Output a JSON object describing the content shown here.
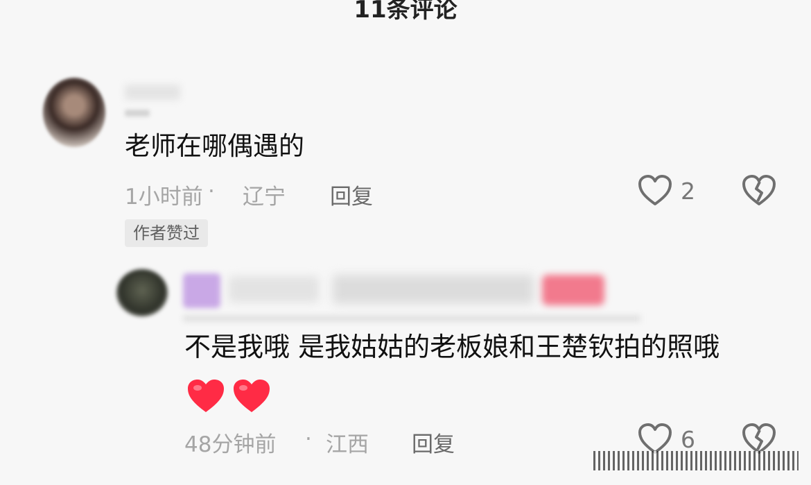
{
  "header": {
    "title": "11条评论"
  },
  "comment": {
    "text": "老师在哪偶遇的",
    "time": "1小时前",
    "separator": "·",
    "location": "辽宁",
    "reply_label": "回复",
    "like_count": "2",
    "badge": "作者赞过"
  },
  "reply_comment": {
    "text": "不是我哦 是我姑姑的老板娘和王楚钦拍的照哦",
    "time": "48分钟前",
    "separator": "·",
    "location": "江西",
    "reply_label": "回复",
    "like_count": "6"
  },
  "colors": {
    "heart_red": "#ff2b45",
    "icon_gray": "#6f6f6f",
    "meta_gray": "#a5a5a5"
  }
}
